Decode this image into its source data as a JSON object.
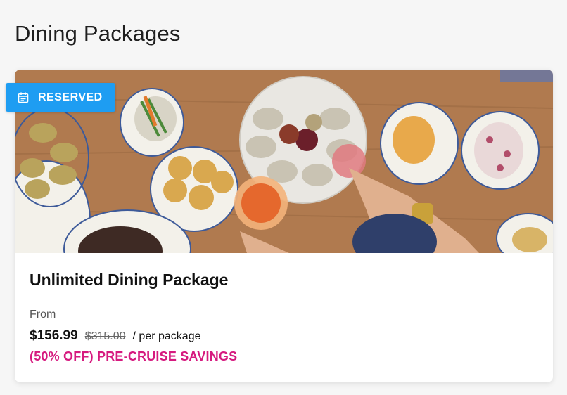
{
  "page": {
    "title": "Dining Packages"
  },
  "card": {
    "badge": {
      "icon": "calendar-icon",
      "label": "RESERVED",
      "color": "#1e9df2"
    },
    "image": {
      "description": "food-table-photo"
    },
    "title": "Unlimited Dining Package",
    "from_label": "From",
    "price": "$156.99",
    "original_price": "$315.00",
    "price_unit": "/ per package",
    "savings": "(50% OFF) PRE-CRUISE SAVINGS",
    "savings_color": "#d61a7f"
  }
}
